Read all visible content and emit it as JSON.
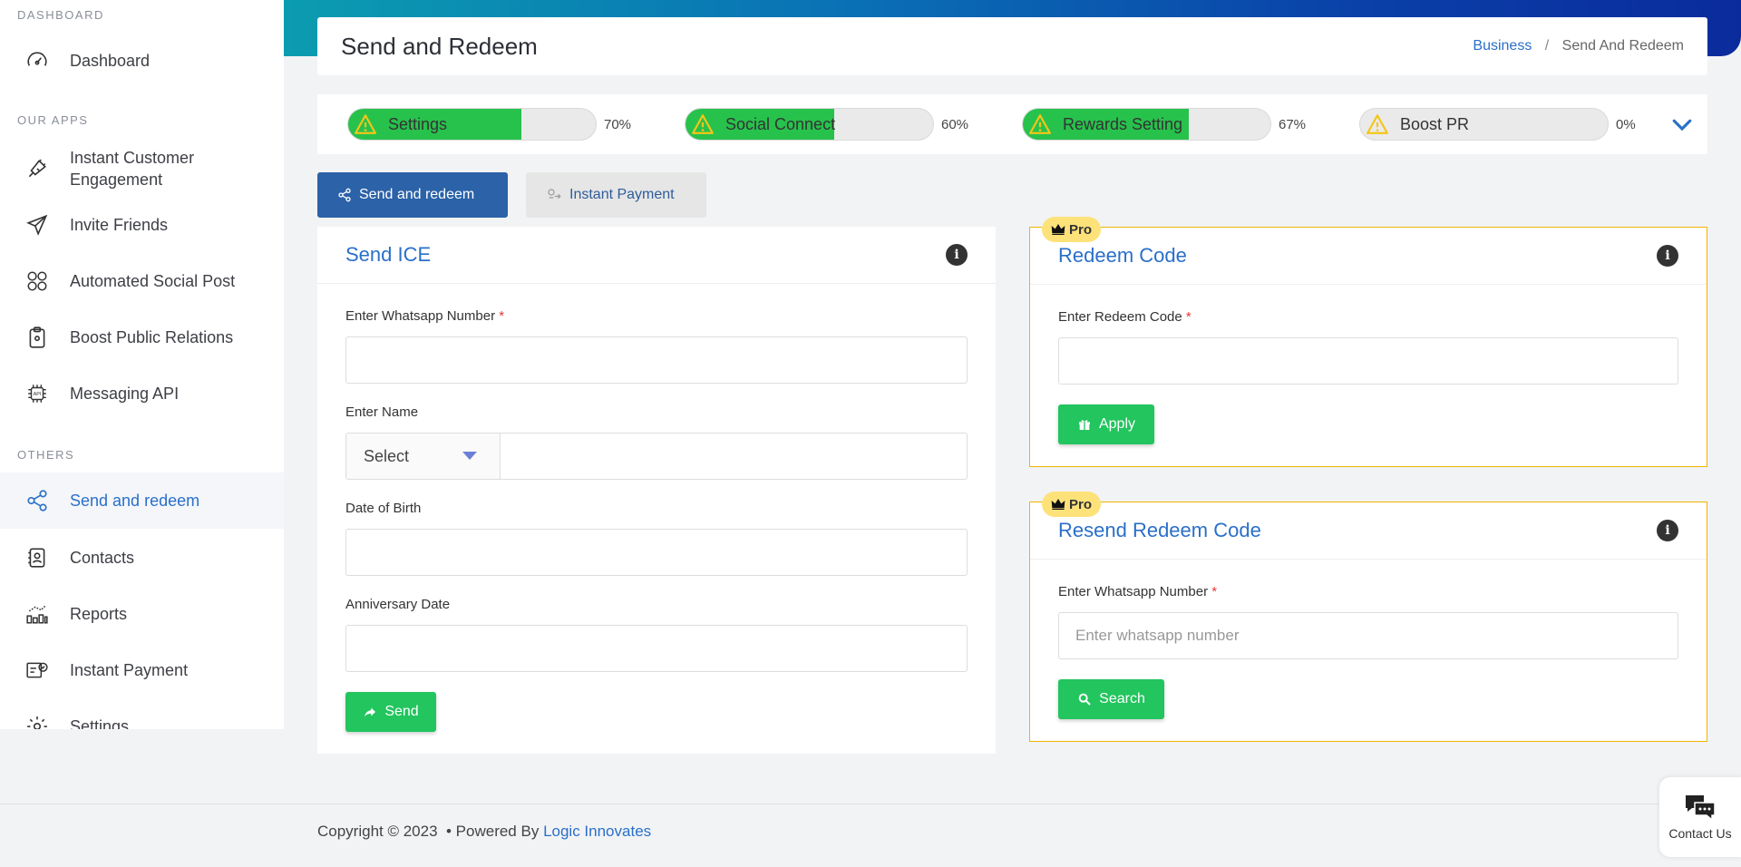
{
  "sidebar": {
    "sections": {
      "dashboard": "DASHBOARD",
      "our_apps": "OUR APPS",
      "others": "OTHERS"
    },
    "items": [
      {
        "label": "Dashboard",
        "icon": "speedometer-icon"
      },
      {
        "label": "Instant Customer Engagement",
        "icon": "megaphone-icon"
      },
      {
        "label": "Invite Friends",
        "icon": "send-icon"
      },
      {
        "label": "Automated Social Post",
        "icon": "social-icon"
      },
      {
        "label": "Boost Public Relations",
        "icon": "clipboard-icon"
      },
      {
        "label": "Messaging API",
        "icon": "api-icon"
      },
      {
        "label": "Send and redeem",
        "icon": "share-icon",
        "active": true
      },
      {
        "label": "Contacts",
        "icon": "contacts-icon"
      },
      {
        "label": "Reports",
        "icon": "reports-icon"
      },
      {
        "label": "Instant Payment",
        "icon": "payment-icon"
      },
      {
        "label": "Settings",
        "icon": "gear-icon"
      }
    ]
  },
  "header": {
    "title": "Send and Redeem",
    "breadcrumb": {
      "link": "Business",
      "separator": "/",
      "current": "Send And Redeem"
    }
  },
  "progress": [
    {
      "label": "Settings",
      "percent_text": "70%",
      "fill": 0.7
    },
    {
      "label": "Social Connect",
      "percent_text": "60%",
      "fill": 0.6
    },
    {
      "label": "Rewards Setting",
      "percent_text": "67%",
      "fill": 0.67
    },
    {
      "label": "Boost PR",
      "percent_text": "0%",
      "fill": 0
    }
  ],
  "tabs": {
    "send_redeem": "Send and redeem",
    "instant_payment": "Instant Payment"
  },
  "send_ice": {
    "title": "Send ICE",
    "whatsapp_label": "Enter Whatsapp Number",
    "required_mark": "*",
    "name_label": "Enter Name",
    "select_value": "Select",
    "dob_label": "Date of Birth",
    "anniversary_label": "Anniversary Date",
    "send_button": "Send"
  },
  "redeem_code": {
    "badge": "Pro",
    "title": "Redeem Code",
    "code_label": "Enter Redeem Code",
    "required_mark": "*",
    "apply_button": "Apply"
  },
  "resend_code": {
    "badge": "Pro",
    "title": "Resend Redeem Code",
    "whatsapp_label": "Enter Whatsapp Number",
    "required_mark": "*",
    "whatsapp_placeholder": "Enter whatsapp number",
    "search_button": "Search"
  },
  "footer": {
    "copyright": "Copyright © 2023  • Powered By ",
    "company": "Logic Innovates"
  },
  "contact": {
    "label": "Contact Us"
  },
  "colors": {
    "primary": "#2a6fc9",
    "success": "#22c55e",
    "pro_border": "#f0b400",
    "tab_active": "#2b62a8"
  }
}
